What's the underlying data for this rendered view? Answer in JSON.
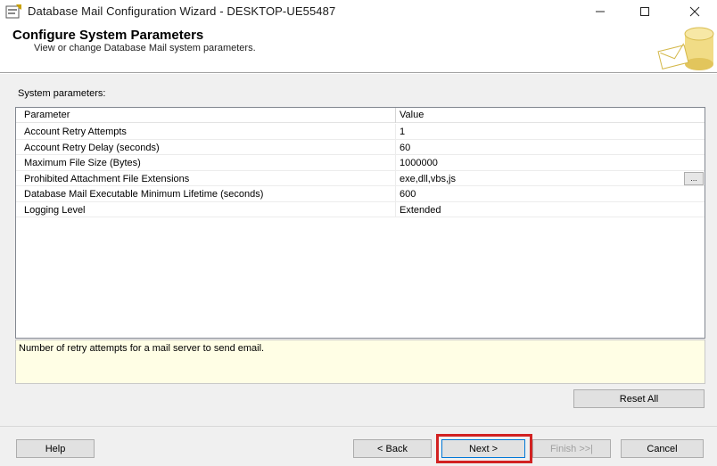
{
  "window": {
    "title": "Database Mail Configuration Wizard - DESKTOP-UE55487",
    "controls": {
      "minimize_icon": "minimize-icon",
      "maximize_icon": "maximize-icon",
      "close_icon": "close-icon"
    }
  },
  "header": {
    "title": "Configure System Parameters",
    "subtitle": "View or change Database Mail system parameters."
  },
  "system": {
    "label": "System parameters:",
    "columns": {
      "parameter": "Parameter",
      "value": "Value"
    },
    "rows": [
      {
        "name": "Account Retry Attempts",
        "value": "1"
      },
      {
        "name": "Account Retry Delay (seconds)",
        "value": "60"
      },
      {
        "name": "Maximum File Size (Bytes)",
        "value": "1000000"
      },
      {
        "name": "Prohibited Attachment File Extensions",
        "value": "exe,dll,vbs,js",
        "ellipsis": "..."
      },
      {
        "name": "Database Mail Executable Minimum Lifetime (seconds)",
        "value": "600"
      },
      {
        "name": "Logging Level",
        "value": "Extended"
      }
    ]
  },
  "description": "Number of retry attempts for a mail server to send email.",
  "buttons": {
    "reset_all": "Reset All",
    "help": "Help",
    "back": "< Back",
    "next": "Next >",
    "finish": "Finish >>|",
    "cancel": "Cancel"
  },
  "colors": {
    "highlight": "#d22222",
    "description_bg": "#fffee5",
    "focus_border": "#0078d7"
  }
}
